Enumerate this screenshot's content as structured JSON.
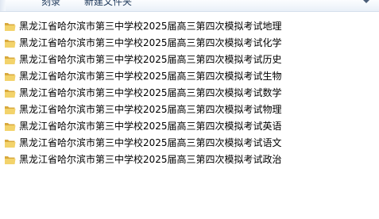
{
  "toolbar": {
    "burn_label": "刻录",
    "new_folder_label": "新建文件夹"
  },
  "files": [
    "黑龙江省哈尔滨市第三中学校2025届高三第四次模拟考试地理",
    "黑龙江省哈尔滨市第三中学校2025届高三第四次模拟考试化学",
    "黑龙江省哈尔滨市第三中学校2025届高三第四次模拟考试历史",
    "黑龙江省哈尔滨市第三中学校2025届高三第四次模拟考试生物",
    "黑龙江省哈尔滨市第三中学校2025届高三第四次模拟考试数学",
    "黑龙江省哈尔滨市第三中学校2025届高三第四次模拟考试物理",
    "黑龙江省哈尔滨市第三中学校2025届高三第四次模拟考试英语",
    "黑龙江省哈尔滨市第三中学校2025届高三第四次模拟考试语文",
    "黑龙江省哈尔滨市第三中学校2025届高三第四次模拟考试政治"
  ],
  "icons": {
    "folder": "folder-icon",
    "dropdown": "chevron-down-icon"
  },
  "colors": {
    "folder_back": "#d9a93c",
    "folder_front": "#f3d36b",
    "toolbar_text": "#1e395b"
  }
}
